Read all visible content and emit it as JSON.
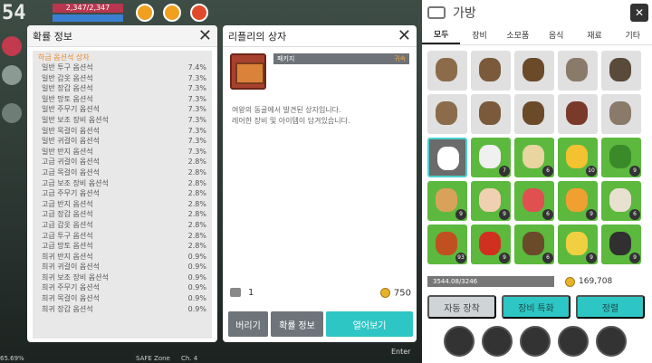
{
  "hud": {
    "level": "54",
    "hp_text": "2,347/2,347",
    "footer": "65.69%",
    "zone": "SAFE Zone",
    "channel": "Ch. 4"
  },
  "prob_panel": {
    "title": "확률 정보",
    "category": "하급 옵션석 상자",
    "rows": [
      {
        "name": "일반 투구 옵션석",
        "pct": "7.4%"
      },
      {
        "name": "일반 갑옷 옵션석",
        "pct": "7.3%"
      },
      {
        "name": "일반 장갑 옵션석",
        "pct": "7.3%"
      },
      {
        "name": "일반 망토 옵션석",
        "pct": "7.3%"
      },
      {
        "name": "일반 주무기 옵션석",
        "pct": "7.3%"
      },
      {
        "name": "일반 보조 장비 옵션석",
        "pct": "7.3%"
      },
      {
        "name": "일반 목걸이 옵션석",
        "pct": "7.3%"
      },
      {
        "name": "일반 귀걸이 옵션석",
        "pct": "7.3%"
      },
      {
        "name": "일반 반지 옵션석",
        "pct": "7.3%"
      },
      {
        "name": "고급 귀걸이 옵션석",
        "pct": "2.8%"
      },
      {
        "name": "고급 목걸이 옵션석",
        "pct": "2.8%"
      },
      {
        "name": "고급 보조 장비 옵션석",
        "pct": "2.8%"
      },
      {
        "name": "고급 주무기 옵션석",
        "pct": "2.8%"
      },
      {
        "name": "고급 반지 옵션석",
        "pct": "2.8%"
      },
      {
        "name": "고급 장갑 옵션석",
        "pct": "2.8%"
      },
      {
        "name": "고급 갑옷 옵션석",
        "pct": "2.8%"
      },
      {
        "name": "고급 투구 옵션석",
        "pct": "2.8%"
      },
      {
        "name": "고급 망토 옵션석",
        "pct": "2.8%"
      },
      {
        "name": "희귀 반지 옵션석",
        "pct": "0.9%"
      },
      {
        "name": "희귀 귀걸이 옵션석",
        "pct": "0.9%"
      },
      {
        "name": "희귀 보조 장비 옵션석",
        "pct": "0.9%"
      },
      {
        "name": "희귀 주무기 옵션석",
        "pct": "0.9%"
      },
      {
        "name": "희귀 목걸이 옵션석",
        "pct": "0.9%"
      },
      {
        "name": "희귀 장갑 옵션석",
        "pct": "0.9%"
      }
    ]
  },
  "box_panel": {
    "title": "리플리의 상자",
    "tag": "패키지",
    "bound": "귀속",
    "desc1": "여왕의 동굴에서 발견된 상자입니다.",
    "desc2": "레어한 장비 및 아이템이 담겨있습니다.",
    "qty": "1",
    "price": "750",
    "btn_discard": "버리기",
    "btn_prob": "확률 정보",
    "btn_open": "열어보기",
    "enter": "Enter"
  },
  "inventory": {
    "title": "가방",
    "tabs": [
      "모두",
      "장비",
      "소모품",
      "음식",
      "재료",
      "기타"
    ],
    "capacity": "3544.08/3246",
    "gold": "169,708",
    "btn_auto": "자동 장착",
    "btn_enhance": "장비 특화",
    "btn_sort": "정렬",
    "counts": [
      "",
      "",
      "",
      "",
      "",
      "",
      "",
      "",
      "",
      "",
      "",
      "7",
      "6",
      "10",
      "9",
      "9",
      "9",
      "6",
      "9",
      "6",
      "93",
      "9",
      "6",
      "9",
      "9"
    ]
  }
}
